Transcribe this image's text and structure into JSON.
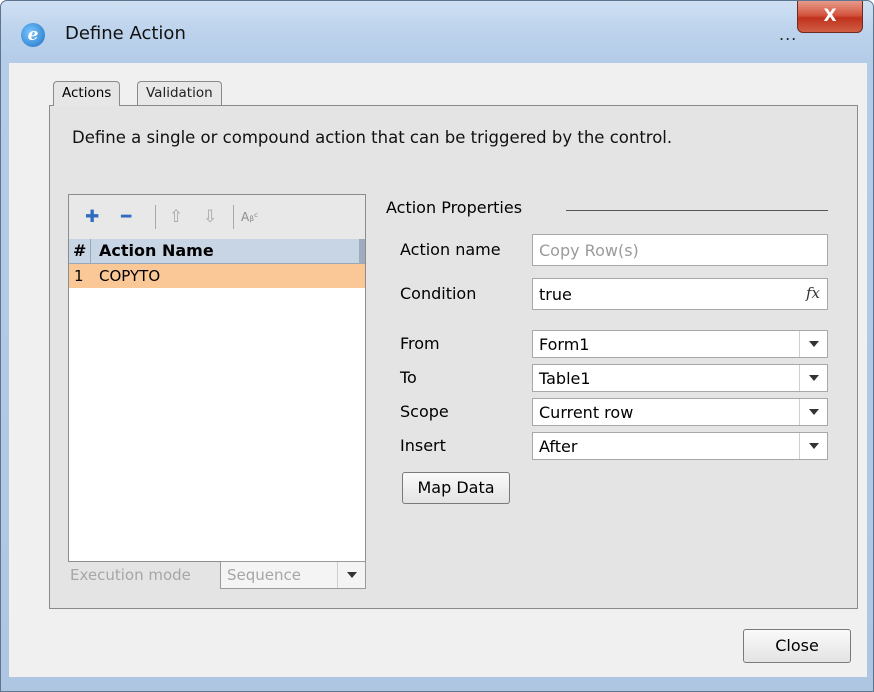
{
  "window": {
    "title": "Define Action",
    "ellipsis": "...",
    "close_glyph": "X"
  },
  "tabs": [
    {
      "label": "Actions"
    },
    {
      "label": "Validation"
    }
  ],
  "description": "Define a single or compound action that can be triggered by the control.",
  "action_list": {
    "toolbar": {
      "add_glyph": "✚",
      "remove_glyph": "━",
      "up_glyph": "⇧",
      "down_glyph": "⇩",
      "rename_glyph": "Aᵦᶜ"
    },
    "columns": [
      "#",
      "Action Name"
    ],
    "rows": [
      {
        "num": "1",
        "name": "COPYTO",
        "selected": true
      }
    ]
  },
  "execution_mode": {
    "label": "Execution mode",
    "value": "Sequence"
  },
  "properties": {
    "title": "Action Properties",
    "action_name": {
      "label": "Action name",
      "placeholder": "Copy Row(s)"
    },
    "condition": {
      "label": "Condition",
      "value": "true",
      "fx": "fx"
    },
    "from": {
      "label": "From",
      "value": "Form1"
    },
    "to": {
      "label": "To",
      "value": "Table1"
    },
    "scope": {
      "label": "Scope",
      "value": "Current row"
    },
    "insert": {
      "label": "Insert",
      "value": "After"
    },
    "map_data": "Map Data"
  },
  "footer": {
    "close": "Close"
  },
  "colors": {
    "selected_row": "#fac796",
    "header_bg": "#c8d5e4",
    "window_frame": "#b4cce8",
    "close_button": "#c0321d"
  }
}
